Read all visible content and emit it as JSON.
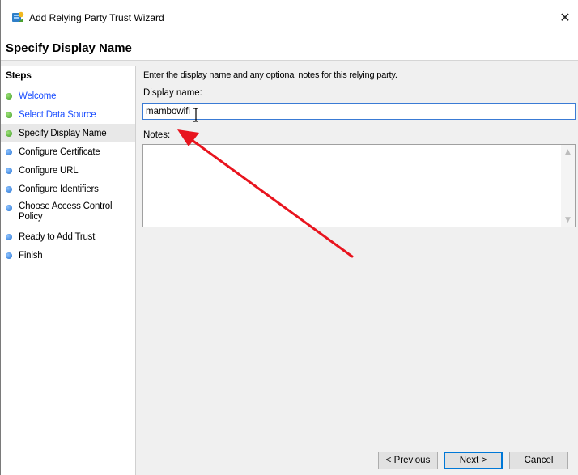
{
  "window": {
    "title": "Add Relying Party Trust Wizard",
    "close_glyph": "✕"
  },
  "header": {
    "title": "Specify Display Name"
  },
  "steps": {
    "title": "Steps",
    "items": [
      {
        "label": "Welcome",
        "state": "done"
      },
      {
        "label": "Select Data Source",
        "state": "done"
      },
      {
        "label": "Specify Display Name",
        "state": "current"
      },
      {
        "label": "Configure Certificate",
        "state": "todo"
      },
      {
        "label": "Configure URL",
        "state": "todo"
      },
      {
        "label": "Configure Identifiers",
        "state": "todo"
      },
      {
        "label": "Choose Access Control Policy",
        "state": "todo"
      },
      {
        "label": "Ready to Add Trust",
        "state": "todo"
      },
      {
        "label": "Finish",
        "state": "todo"
      }
    ]
  },
  "form": {
    "instruction": "Enter the display name and any optional notes for this relying party.",
    "display_name_label": "Display name:",
    "display_name_value": "mambowifi",
    "notes_label": "Notes:",
    "notes_value": ""
  },
  "buttons": {
    "previous": "< Previous",
    "next": "Next >",
    "cancel": "Cancel"
  },
  "colors": {
    "annotation_arrow": "#e8141e",
    "link_blue": "#1a4dff",
    "focus_blue": "#0078d7"
  }
}
